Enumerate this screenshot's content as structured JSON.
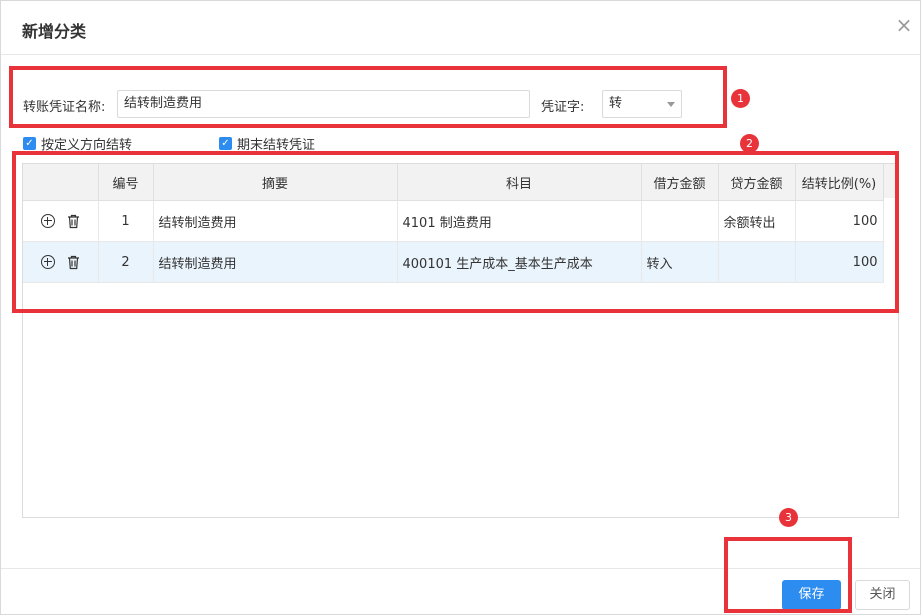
{
  "dialog": {
    "title": "新增分类",
    "close_icon": "×"
  },
  "form": {
    "name_label": "转账凭证名称:",
    "name_value": "结转制造费用",
    "word_label": "凭证字:",
    "word_value": "转"
  },
  "options": {
    "by_direction": {
      "label": "按定义方向结转",
      "checked": true
    },
    "period_end": {
      "label": "期末结转凭证",
      "checked": true
    }
  },
  "table": {
    "headers": [
      "",
      "编号",
      "摘要",
      "科目",
      "借方金额",
      "贷方金额",
      "结转比例(%)"
    ],
    "rows": [
      {
        "no": "1",
        "summary": "结转制造费用",
        "account": "4101 制造费用",
        "debit": "",
        "credit": "余额转出",
        "ratio": "100"
      },
      {
        "no": "2",
        "summary": "结转制造费用",
        "account": "400101 生产成本_基本生产成本",
        "debit": "转入",
        "credit": "",
        "ratio": "100"
      }
    ]
  },
  "annotations": {
    "badge1": "1",
    "badge2": "2",
    "badge3": "3",
    "color": "#e8333a"
  },
  "footer": {
    "save_label": "保存",
    "close_label": "关闭"
  },
  "colors": {
    "primary": "#2d8cf0",
    "row_highlight": "#eaf4fd"
  }
}
